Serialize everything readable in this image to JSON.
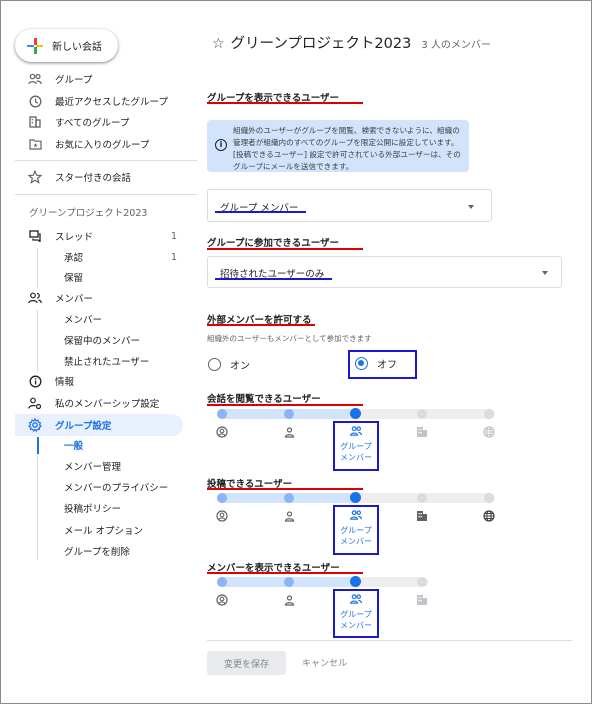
{
  "sidebar": {
    "new_chat_label": "新しい会話",
    "top_items": [
      {
        "label": "グループ",
        "icon": "people-icon"
      },
      {
        "label": "最近アクセスしたグループ",
        "icon": "clock-icon"
      },
      {
        "label": "すべてのグループ",
        "icon": "building-icon"
      },
      {
        "label": "お気に入りのグループ",
        "icon": "folder-star-icon"
      }
    ],
    "starred_label": "スター付きの会話",
    "group_name": "グリーンプロジェクト2023",
    "threads_label": "スレッド",
    "threads_count": "1",
    "threads_sub": [
      {
        "label": "承認",
        "count": "1"
      },
      {
        "label": "保留",
        "count": ""
      }
    ],
    "members_label": "メンバー",
    "members_sub": [
      "メンバー",
      "保留中のメンバー",
      "禁止されたユーザー"
    ],
    "info_label": "情報",
    "my_membership_label": "私のメンバーシップ設定",
    "group_settings_label": "グループ設定",
    "settings_sub": [
      "一般",
      "メンバー管理",
      "メンバーのプライバシー",
      "投稿ポリシー",
      "メール オプション",
      "グループを削除"
    ]
  },
  "header": {
    "title": "グリーンプロジェクト2023",
    "member_count": "3 人のメンバー"
  },
  "main": {
    "view_group": {
      "heading": "グループを表示できるユーザー",
      "info": "組織外のユーザーがグループを閲覧、検索できないように、組織の管理者が組織内のすべてのグループを限定公開に設定しています。[投稿できるユーザー] 設定で許可されている外部ユーザーは、そのグループにメールを送信できます。",
      "value": "グループ メンバー"
    },
    "join_group": {
      "heading": "グループに参加できるユーザー",
      "value": "招待されたユーザーのみ"
    },
    "external": {
      "heading": "外部メンバーを許可する",
      "desc": "組織外のユーザーもメンバーとして参加できます",
      "on_label": "オン",
      "off_label": "オフ",
      "selected": "オフ"
    },
    "view_conversations": {
      "heading": "会話を閲覧できるユーザー",
      "selected_label": "グループ\nメンバー",
      "selected_level": 3,
      "levels": [
        "manager-icon",
        "person-icon",
        "group-icon",
        "building-icon",
        "globe-icon"
      ]
    },
    "post": {
      "heading": "投稿できるユーザー",
      "selected_label": "グループ\nメンバー",
      "selected_level": 3,
      "levels": [
        "manager-icon",
        "person-icon",
        "group-icon",
        "building-icon",
        "globe-icon"
      ]
    },
    "view_members": {
      "heading": "メンバーを表示できるユーザー",
      "selected_label": "グループ\nメンバー",
      "selected_level": 3,
      "levels": [
        "manager-icon",
        "person-icon",
        "group-icon",
        "building-icon"
      ]
    },
    "save_label": "変更を保存",
    "cancel_label": "キャンセル"
  },
  "colors": {
    "accent": "#1a73e8",
    "annotation_red": "#dd0000",
    "annotation_blue": "#1a1acc",
    "selected_bg": "#e8f0fe"
  }
}
